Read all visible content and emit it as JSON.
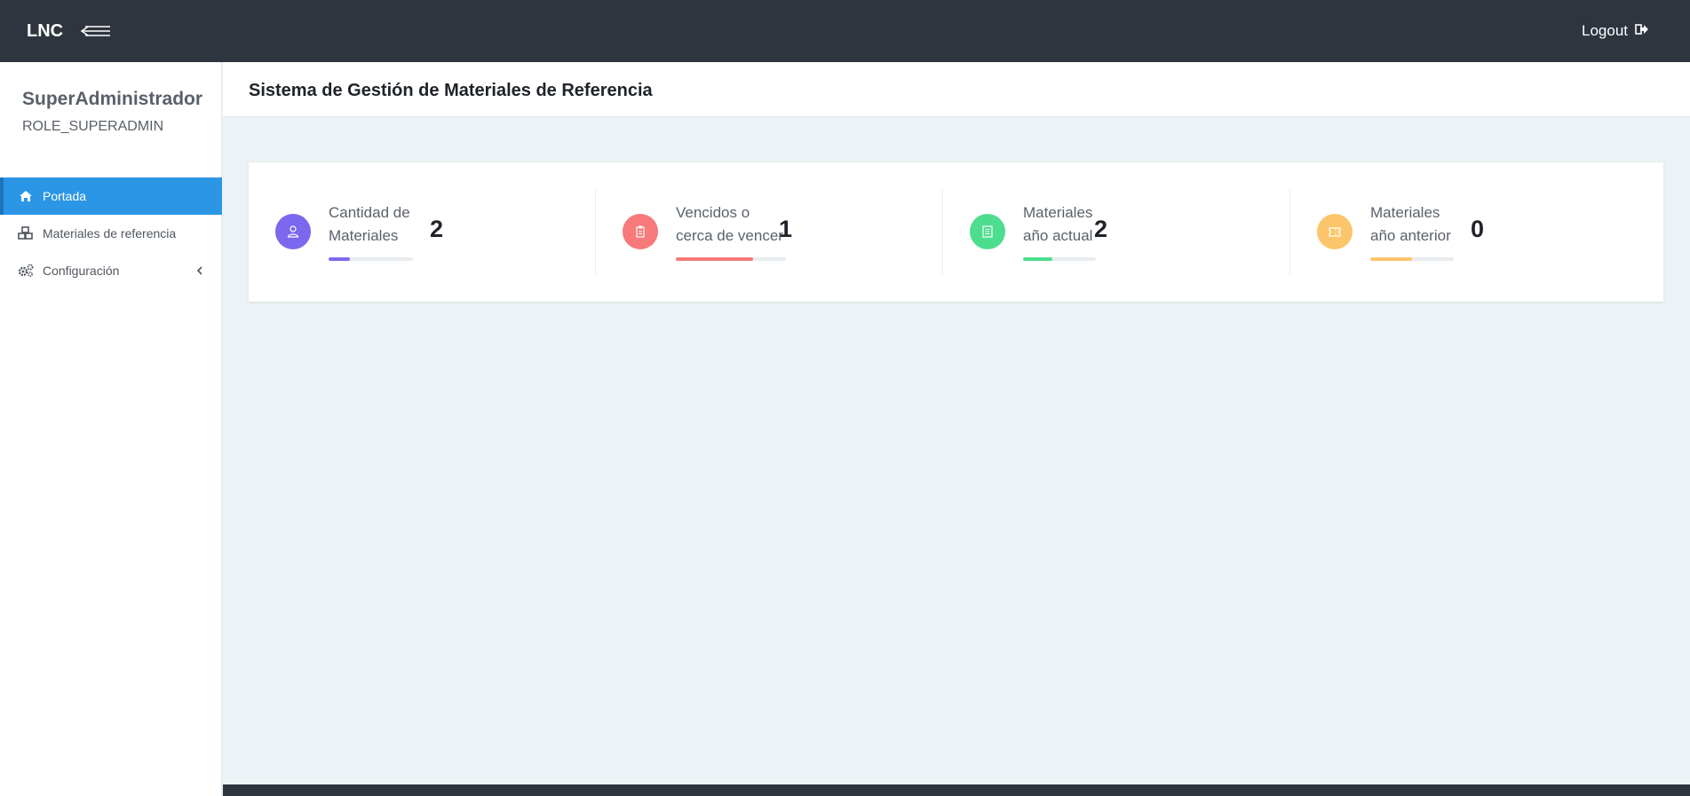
{
  "topbar": {
    "brand": "LNC",
    "menu_icon": "menu-toggle-icon",
    "logout_label": "Logout",
    "logout_icon": "sign-out-icon"
  },
  "sidebar": {
    "user_name": "SuperAdministrador",
    "user_role": "ROLE_SUPERADMIN",
    "items": [
      {
        "label": "Portada",
        "icon": "home-icon",
        "active": true
      },
      {
        "label": "Materiales de referencia",
        "icon": "cubes-icon",
        "active": false
      },
      {
        "label": "Configuración",
        "icon": "cogs-icon",
        "active": false,
        "has_submenu": true
      }
    ]
  },
  "header": {
    "title": "Sistema de Gestión de Materiales de Referencia"
  },
  "stats": [
    {
      "label_line1": "Cantidad de",
      "label_line2": "Materiales",
      "value": "2",
      "icon": "user-icon",
      "color": "#7b68ee",
      "progress": 0.25
    },
    {
      "label_line1": "Vencidos o",
      "label_line2": "cerca de vencer",
      "value": "1",
      "icon": "clipboard-icon",
      "color": "#f77979",
      "progress": 0.7
    },
    {
      "label_line1": "Materiales",
      "label_line2": "año actual",
      "value": "2",
      "icon": "document-icon",
      "color": "#4cdd8f",
      "progress": 0.4
    },
    {
      "label_line1": "Materiales",
      "label_line2": "año anterior",
      "value": "0",
      "icon": "ticket-icon",
      "color": "#fdc56b",
      "progress": 0.5
    }
  ],
  "colors": {
    "topbar": "#2f353f",
    "active_nav": "#2b96e6",
    "background": "#ecf3f6"
  }
}
